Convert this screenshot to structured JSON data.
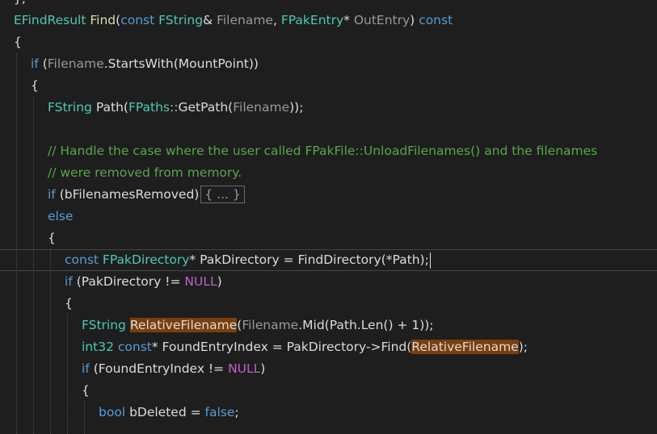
{
  "editor": {
    "top_fragment": "};",
    "sig": {
      "ret": "EFindResult",
      "name": "Find",
      "open": "(",
      "const1": "const",
      "type1": "FString",
      "amp": "&",
      "param1": "Filename",
      "comma": ",",
      "type2": "FPakEntry",
      "star": "*",
      "param2": "OutEntry",
      "close": ")",
      "const2": "const"
    },
    "brace_open": "{",
    "if1": {
      "kw": "if",
      "open": "(",
      "var": "Filename",
      "dot": ".",
      "method": "StartsWith",
      "arg": "(MountPoint))"
    },
    "path_line": {
      "type": "FString",
      "name": "Path",
      "open": "(",
      "cls": "FPaths",
      "sep": "::",
      "method": "GetPath",
      "open2": "(",
      "arg": "Filename",
      "close": "));"
    },
    "comment1": "// Handle the case where the user called FPakFile::UnloadFilenames() and the filenames",
    "comment2": "// were removed from memory.",
    "if2": {
      "kw": "if",
      "cond": "(bFilenamesRemoved)",
      "collapsed": "{ ... }"
    },
    "else_kw": "else",
    "pakdir_line": {
      "kw": "const",
      "type": "FPakDirectory",
      "rest": "* PakDirectory = FindDirectory(*Path);"
    },
    "if3": {
      "kw": "if",
      "cond_open": "(PakDirectory != ",
      "macro": "NULL",
      "cond_close": ")"
    },
    "relfile_line": {
      "type": "FString",
      "name": "RelativeFilename",
      "open": "(",
      "var": "Filename",
      "rest": ".Mid(Path.Len() + 1));"
    },
    "index_line": {
      "type": "int32",
      "kw": "const",
      "mid": "* FoundEntryIndex = PakDirectory->Find(",
      "hl": "RelativeFilename",
      "end": ");"
    },
    "if4": {
      "kw": "if",
      "cond_open": "(FoundEntryIndex != ",
      "macro": "NULL",
      "cond_close": ")"
    },
    "bool_line": {
      "type": "bool",
      "name": "bDeleted",
      "eq": " = ",
      "val": "false",
      "semi": ";"
    }
  }
}
